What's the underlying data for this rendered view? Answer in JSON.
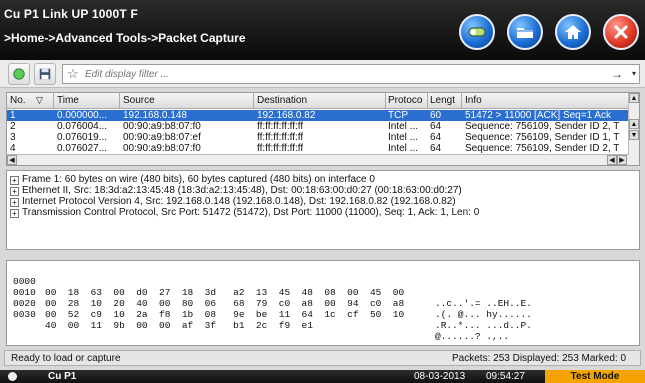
{
  "header": {
    "title": "Cu P1 Link UP 1000T F",
    "breadcrumb": ">Home->Advanced Tools->Packet Capture"
  },
  "header_buttons": [
    {
      "icon": "toggle-icon"
    },
    {
      "icon": "folder-icon"
    },
    {
      "icon": "home-icon"
    },
    {
      "icon": "close-icon"
    }
  ],
  "toolbar": {
    "filter_placeholder": "Edit display filter ...",
    "filter_apply": "→",
    "filter_dropdown": "▾"
  },
  "packet_list": {
    "columns": [
      "No.",
      "Time",
      "Source",
      "Destination",
      "Protoco",
      "Lengt",
      "Info"
    ],
    "rows": [
      {
        "no": "1",
        "time": "0.000000...",
        "source": "192.168.0.148",
        "destination": "192.168.0.82",
        "protocol": "TCP",
        "length": "60",
        "info": "51472 > 11000 [ACK] Seq=1 Ack"
      },
      {
        "no": "2",
        "time": "0.076004...",
        "source": "00:90:a9:b8:07:f0",
        "destination": "ff:ff:ff:ff:ff:ff",
        "protocol": "Intel ...",
        "length": "64",
        "info": "Sequence: 756109, Sender ID 2, T"
      },
      {
        "no": "3",
        "time": "0.076019...",
        "source": "00:90:a9:b8:07:ef",
        "destination": "ff:ff:ff:ff:ff:ff",
        "protocol": "Intel ...",
        "length": "64",
        "info": "Sequence: 756109, Sender ID 1, T"
      },
      {
        "no": "4",
        "time": "0.076027...",
        "source": "00:90:a9:b8:07:f0",
        "destination": "ff:ff:ff:ff:ff:ff",
        "protocol": "Intel ...",
        "length": "64",
        "info": "Sequence: 756109, Sender ID 2, T"
      }
    ]
  },
  "details": [
    "Frame 1: 60 bytes on wire (480 bits), 60 bytes captured (480 bits) on interface 0",
    "Ethernet II, Src: 18:3d:a2:13:45:48 (18:3d:a2:13:45:48), Dst: 00:18:63:00:d0:27 (00:18:63:00:d0:27)",
    "Internet Protocol Version 4, Src: 192.168.0.148 (192.168.0.148), Dst: 192.168.0.82 (192.168.0.82)",
    "Transmission Control Protocol, Src Port: 51472 (51472), Dst Port: 11000 (11000), Seq: 1, Ack: 1, Len: 0"
  ],
  "hex_dump": [
    {
      "offset": "0000",
      "bytes": "00  18  63  00  d0  27  18  3d   a2  13  45  48  08  00  45  00",
      "ascii": "..c..'.= ..EH..E."
    },
    {
      "offset": "0010",
      "bytes": "00  28  10  20  40  00  80  06   68  79  c0  a8  00  94  c0  a8",
      "ascii": ".(. @... hy......"
    },
    {
      "offset": "0020",
      "bytes": "00  52  c9  10  2a  f8  1b  08   9e  be  11  64  1c  cf  50  10",
      "ascii": ".R..*... ...d..P."
    },
    {
      "offset": "0030",
      "bytes": "40  00  11  9b  00  00  af  3f   b1  2c  f9  e1",
      "ascii": "@......? .,.."
    }
  ],
  "status": {
    "left": "Ready to load or capture",
    "right": "Packets: 253 Displayed: 253 Marked: 0"
  },
  "bottom": {
    "interface": "Cu P1",
    "date": "08-03-2013",
    "time": "09:54:27",
    "mode": "Test Mode"
  },
  "colors": {
    "accent_blue": "#1d6fd6",
    "close_red": "#e23a2a",
    "selection": "#2a6fd0",
    "mode_orange": "#f4a300"
  }
}
